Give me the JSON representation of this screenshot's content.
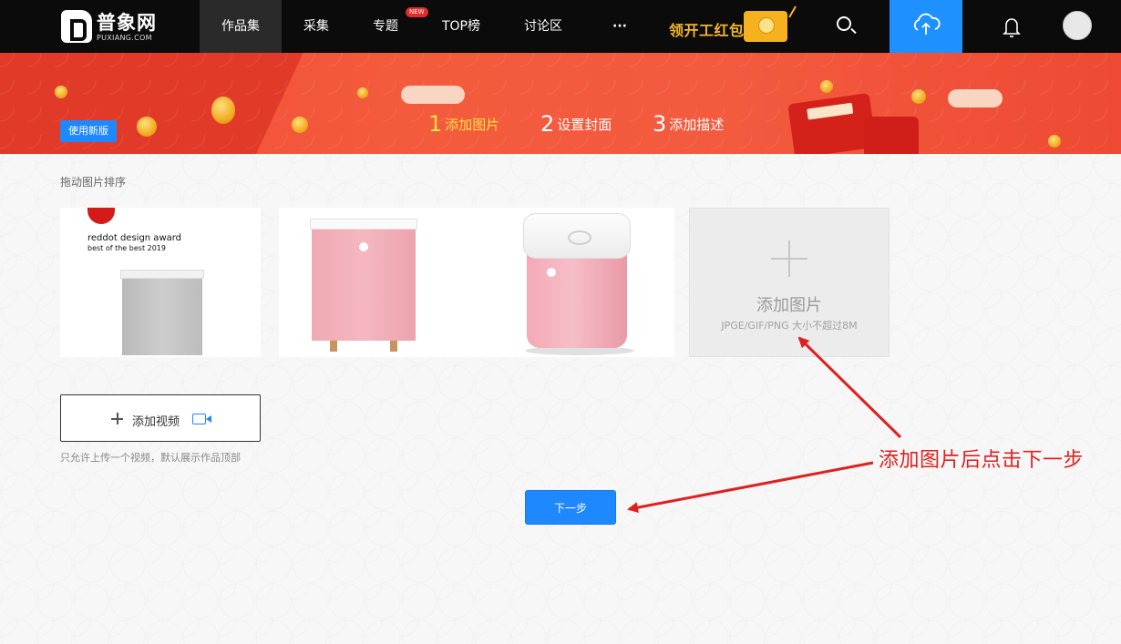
{
  "nav": {
    "logo_text": "普象网",
    "logo_sub": "PUXIANG.COM",
    "items": [
      {
        "label": "作品集",
        "active": true
      },
      {
        "label": "采集"
      },
      {
        "label": "专题",
        "badge": "NEW"
      },
      {
        "label": "TOP榜"
      },
      {
        "label": "讨论区"
      },
      {
        "label": "···"
      }
    ],
    "hongbao_text": "领开工红包",
    "icons": [
      "search-icon",
      "upload-cloud-icon",
      "bell-icon",
      "avatar"
    ],
    "colors": {
      "bar": "#0b0b0b",
      "upload": "#1e90ff",
      "hongbao": "#f4b62a"
    }
  },
  "banner": {
    "use_new_label": "使用新版",
    "steps": [
      {
        "num": "1",
        "label": "添加图片",
        "active": true
      },
      {
        "num": "2",
        "label": "设置封面"
      },
      {
        "num": "3",
        "label": "添加描述"
      }
    ],
    "colors": {
      "bg": "#f35a3e",
      "active_step": "#ffe04a"
    }
  },
  "main": {
    "sort_hint": "拖动图片排序",
    "images": [
      {
        "name": "reddot-grey-box",
        "caption_1": "reddot design award",
        "caption_2": "best of the best 2019"
      },
      {
        "name": "pink-box-with-legs"
      },
      {
        "name": "pink-box-with-white-lid"
      }
    ],
    "add_image": {
      "title": "添加图片",
      "subtitle": "JPGE/GIF/PNG 大小不超过8M"
    },
    "add_video": {
      "label": "添加视频",
      "hint": "只允许上传一个视频，默认展示作品顶部"
    },
    "next_label": "下一步",
    "annotation": "添加图片后点击下一步",
    "colors": {
      "primary": "#1e88ff",
      "annotation": "#e01f1f"
    }
  }
}
